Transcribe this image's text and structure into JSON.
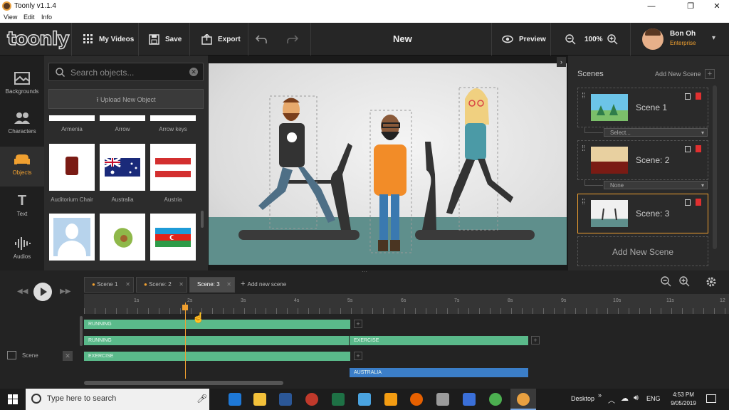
{
  "window": {
    "title": "Toonly v1.1.4",
    "minimize": "—",
    "maximize": "❐",
    "close": "✕"
  },
  "menu": [
    "View",
    "Edit",
    "Info"
  ],
  "toolbar": {
    "logo": "toonly",
    "my_videos": "My Videos",
    "save": "Save",
    "export": "Export",
    "project_name": "New",
    "preview": "Preview",
    "zoom": "100%",
    "user_name": "Bon Oh",
    "user_plan": "Enterprise"
  },
  "rail": [
    "Backgrounds",
    "Characters",
    "Objects",
    "Text",
    "Audios"
  ],
  "objects": {
    "search_placeholder": "Search objects...",
    "upload_label": "Upload New Object",
    "row1": [
      "Armenia",
      "Arrow",
      "Arrow keys"
    ],
    "row2": [
      "Auditorium Chair",
      "Australia",
      "Austria"
    ]
  },
  "scenes_panel": {
    "header": "Scenes",
    "add_top": "Add New Scene",
    "scenes": [
      "Scene 1",
      "Scene: 2",
      "Scene: 3"
    ],
    "transitions": [
      "Select...",
      "None"
    ],
    "add_bottom": "Add New Scene"
  },
  "timeline": {
    "tabs": [
      "Scene 1",
      "Scene: 2",
      "Scene: 3"
    ],
    "add_scene": "Add new scene",
    "ticks": [
      "1s",
      "2s",
      "3s",
      "4s",
      "5s",
      "6s",
      "7s",
      "8s",
      "9s",
      "10s",
      "11s",
      "12"
    ],
    "row_label": "Scene",
    "tracks": {
      "t1": "RUNNING",
      "t2a": "RUNNING",
      "t2b": "EXERCISE",
      "t3": "EXERCISE",
      "t4": "AUSTRALIA"
    }
  },
  "taskbar": {
    "search_placeholder": "Type here to search",
    "desktop": "Desktop",
    "lang": "ENG",
    "time": "4:53 PM",
    "date": "9/05/2019"
  }
}
